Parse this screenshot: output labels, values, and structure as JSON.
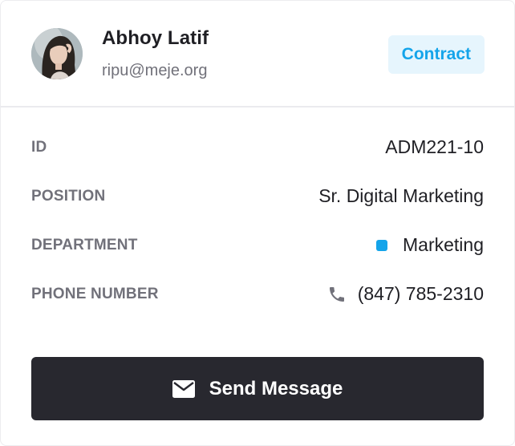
{
  "profile": {
    "name": "Abhoy Latif",
    "email": "ripu@meje.org",
    "badge": "Contract"
  },
  "details": [
    {
      "label": "ID",
      "value": "ADM221-10"
    },
    {
      "label": "POSITION",
      "value": "Sr. Digital Marketing"
    },
    {
      "label": "DEPARTMENT",
      "value": "Marketing",
      "dot_color": "#14a4ea"
    },
    {
      "label": "PHONE NUMBER",
      "value": "(847) 785-2310",
      "icon": "phone-icon"
    }
  ],
  "actions": {
    "send_label": "Send Message",
    "send_icon": "mail-icon"
  },
  "colors": {
    "accent": "#14a4ea",
    "button_bg": "#28282f"
  }
}
